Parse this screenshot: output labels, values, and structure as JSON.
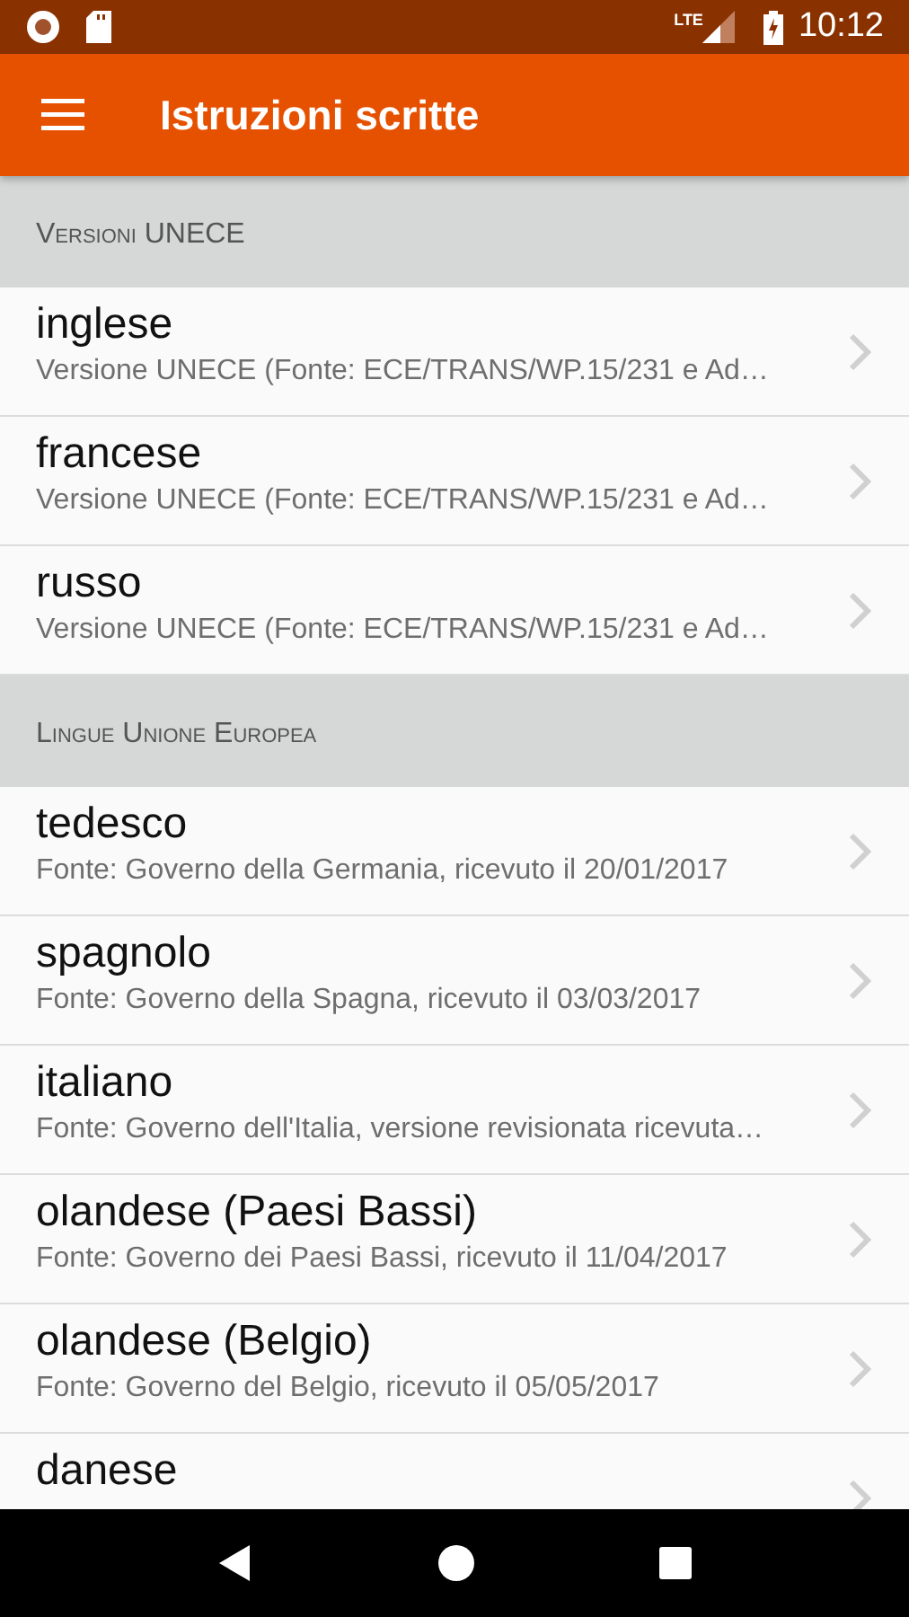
{
  "status_bar": {
    "time": "10:12",
    "network": "LTE"
  },
  "toolbar": {
    "title": "Istruzioni scritte"
  },
  "sections": [
    {
      "header": "Versioni UNECE",
      "items": [
        {
          "title": "inglese",
          "subtitle": "Versione UNECE (Fonte: ECE/TRANS/WP.15/231 e Ad…"
        },
        {
          "title": "francese",
          "subtitle": "Versione UNECE (Fonte: ECE/TRANS/WP.15/231 e Ad…"
        },
        {
          "title": "russo",
          "subtitle": "Versione UNECE (Fonte: ECE/TRANS/WP.15/231 e Ad…"
        }
      ]
    },
    {
      "header": "Lingue Unione Europea",
      "items": [
        {
          "title": "tedesco",
          "subtitle": "Fonte: Governo della Germania, ricevuto il 20/01/2017"
        },
        {
          "title": "spagnolo",
          "subtitle": "Fonte: Governo della Spagna, ricevuto il 03/03/2017"
        },
        {
          "title": "italiano",
          "subtitle": "Fonte: Governo dell'Italia, versione revisionata ricevuta…"
        },
        {
          "title": "olandese (Paesi Bassi)",
          "subtitle": "Fonte: Governo dei Paesi Bassi, ricevuto il 11/04/2017"
        },
        {
          "title": "olandese (Belgio)",
          "subtitle": "Fonte: Governo del Belgio, ricevuto il 05/05/2017"
        },
        {
          "title": "danese"
        }
      ]
    }
  ]
}
